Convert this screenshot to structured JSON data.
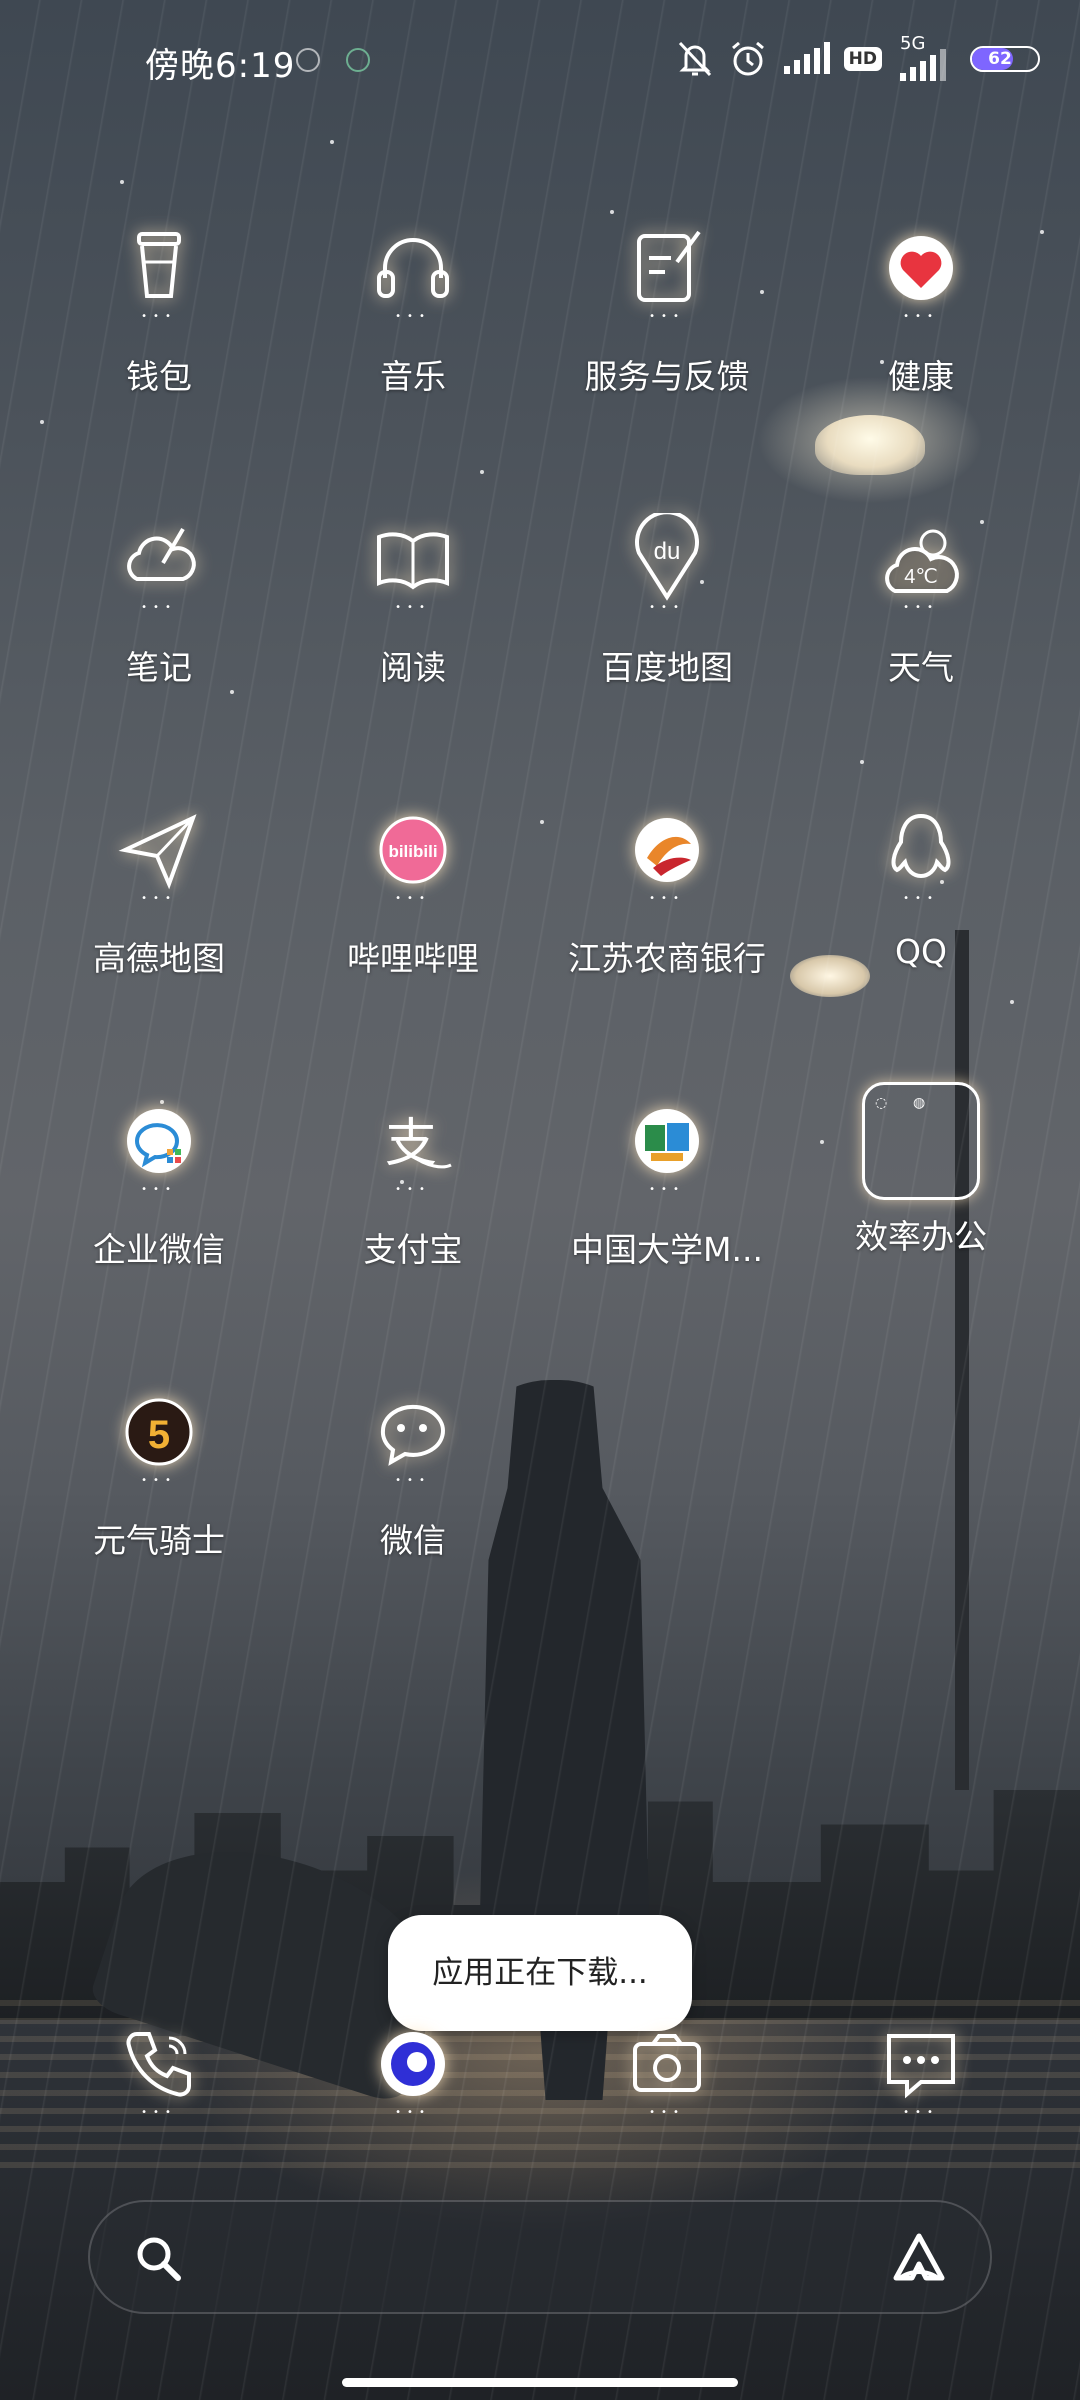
{
  "status_bar": {
    "time": "傍晚6:19",
    "hd": "HD",
    "network": "5G",
    "battery": "62",
    "battery_level": 0.62,
    "icons": [
      "app-notification-icon",
      "app-notification-icon-2",
      "mute-bell-icon",
      "alarm-icon",
      "signal-icon",
      "hd-icon",
      "signal-5g-icon",
      "battery-icon"
    ]
  },
  "apps": [
    {
      "label": "钱包",
      "icon": "wallet-cup-icon"
    },
    {
      "label": "音乐",
      "icon": "headphones-icon"
    },
    {
      "label": "服务与反馈",
      "icon": "feedback-icon"
    },
    {
      "label": "健康",
      "icon": "heart-icon"
    },
    {
      "label": "笔记",
      "icon": "notes-cloud-icon"
    },
    {
      "label": "阅读",
      "icon": "book-icon"
    },
    {
      "label": "百度地图",
      "icon": "baidu-map-pin-icon",
      "badge": "du"
    },
    {
      "label": "天气",
      "icon": "weather-icon",
      "badge": "4℃"
    },
    {
      "label": "高德地图",
      "icon": "paper-plane-icon"
    },
    {
      "label": "哔哩哔哩",
      "icon": "bilibili-icon",
      "badge": "bilibili"
    },
    {
      "label": "江苏农商银行",
      "icon": "bank-icon"
    },
    {
      "label": "QQ",
      "icon": "penguin-icon"
    },
    {
      "label": "企业微信",
      "icon": "wecom-icon"
    },
    {
      "label": "支付宝",
      "icon": "alipay-icon",
      "badge": "支"
    },
    {
      "label": "中国大学M...",
      "icon": "mooc-icon"
    },
    {
      "label": "效率办公",
      "icon": "folder-icon"
    },
    {
      "label": "元气骑士",
      "icon": "soul-knight-icon",
      "badge": "5"
    },
    {
      "label": "微信",
      "icon": "wechat-icon"
    }
  ],
  "toast": {
    "text": "应用正在下载..."
  },
  "dock": [
    {
      "label": "",
      "icon": "phone-icon"
    },
    {
      "label": "",
      "icon": "browser-icon"
    },
    {
      "label": "",
      "icon": "camera-icon"
    },
    {
      "label": "",
      "icon": "messages-icon"
    }
  ],
  "search_bar": {
    "icon": "search-icon",
    "assistant_icon": "assistant-icon"
  }
}
